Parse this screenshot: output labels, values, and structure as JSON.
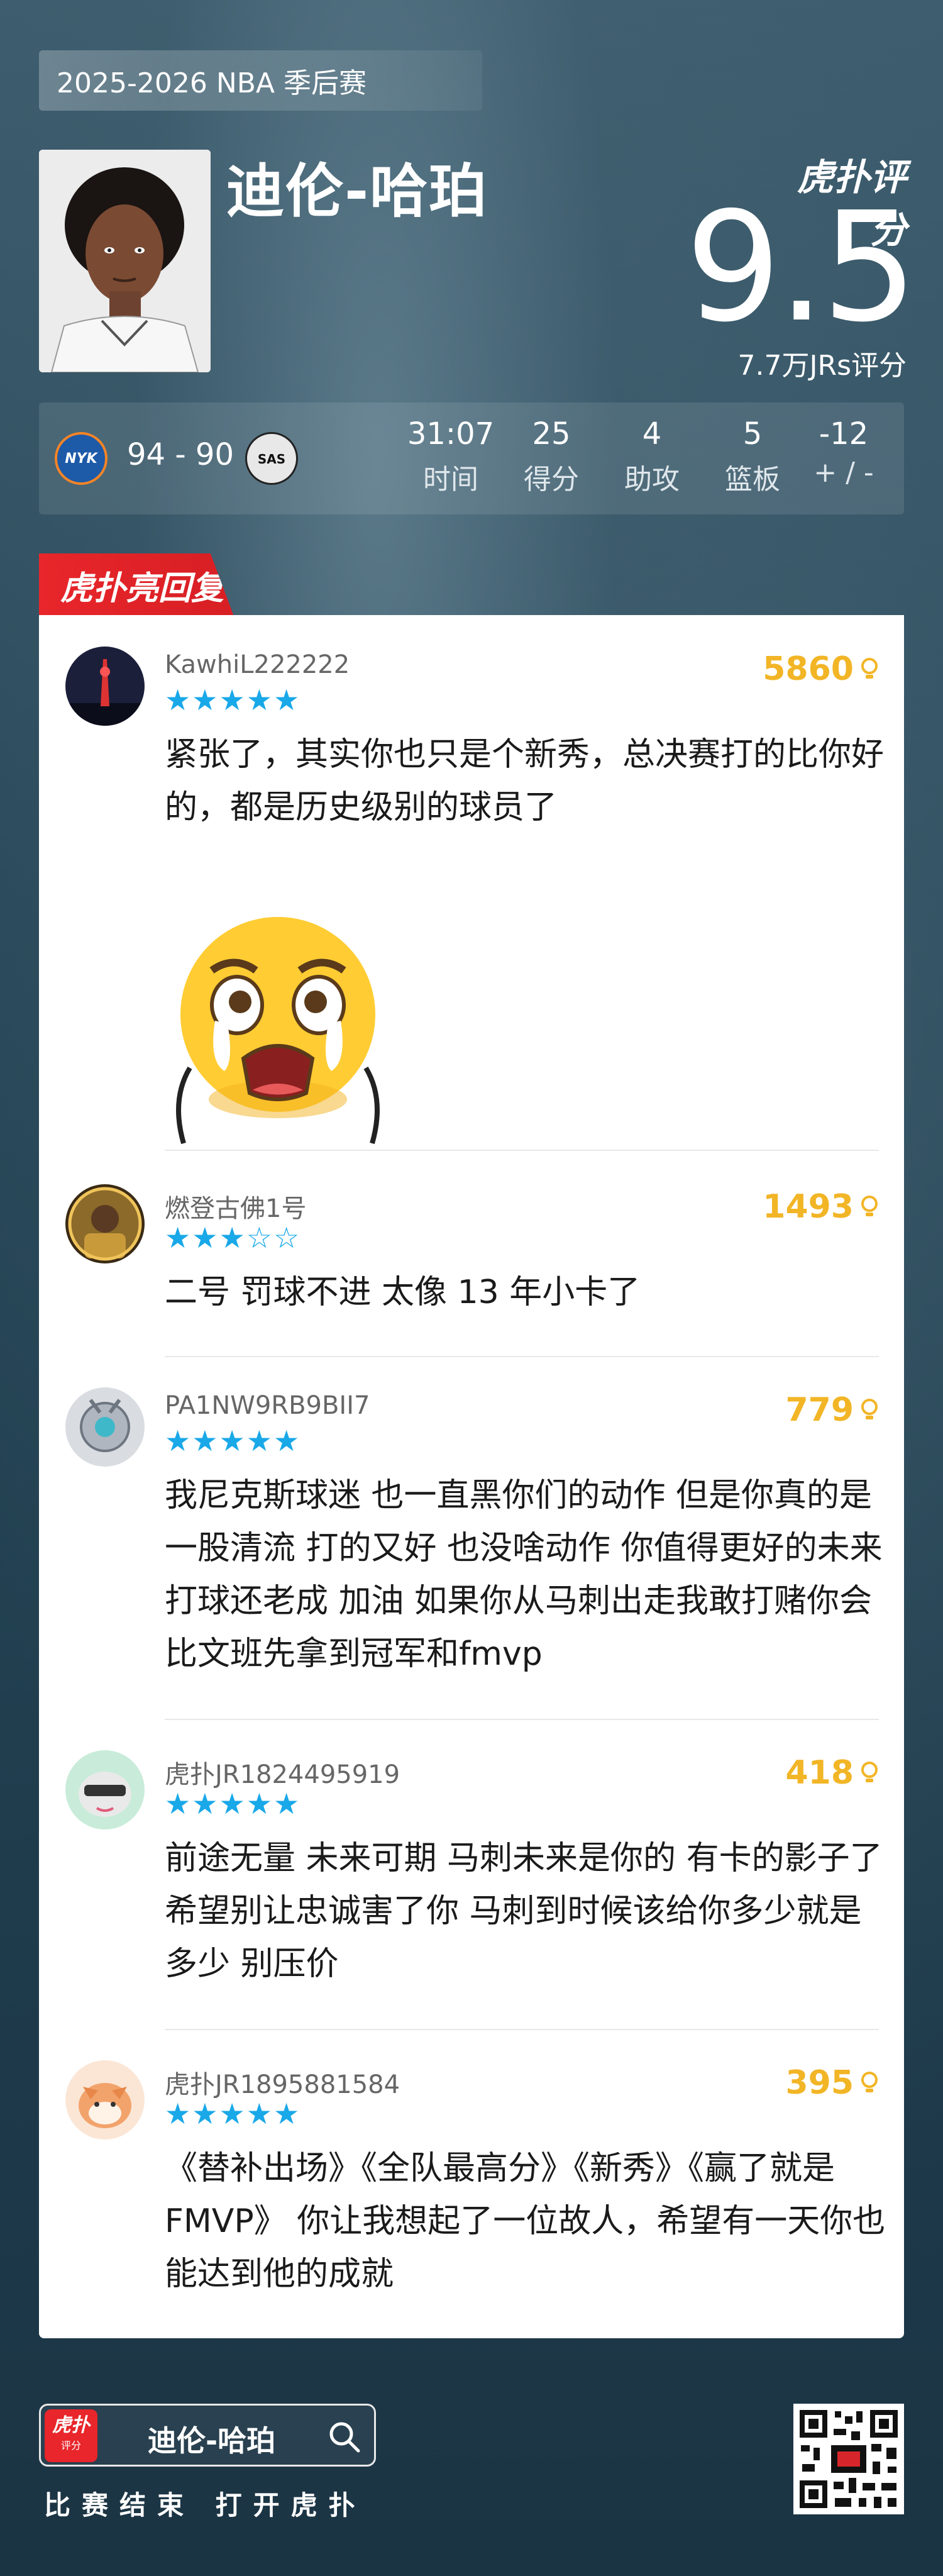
{
  "season": "2025-2026 NBA 季后赛",
  "player": {
    "name": "迪伦-哈珀",
    "rating": "9.5",
    "votes": "7.7万JRs评分",
    "brand": "虎扑评分"
  },
  "game": {
    "home_team": "NYK",
    "away_team": "SAS",
    "score": "94 - 90",
    "stats": [
      {
        "value": "31:07",
        "label": "时间"
      },
      {
        "value": "25",
        "label": "得分"
      },
      {
        "value": "4",
        "label": "助攻"
      },
      {
        "value": "5",
        "label": "篮板"
      },
      {
        "value": "-12",
        "label": "+ / -"
      }
    ]
  },
  "highlight_tag": "虎扑亮回复",
  "comments": [
    {
      "user": "KawhiL222222",
      "stars": 5,
      "likes": "5860",
      "text": "紧张了，其实你也只是个新秀，总决赛打的比你好的，都是历史级别的球员了"
    },
    {
      "user": "燃登古佛1号",
      "stars": 3,
      "likes": "1493",
      "text": "二号 罚球不进 太像 13 年小卡了"
    },
    {
      "user": "PA1NW9RB9BII7",
      "stars": 5,
      "likes": "779",
      "text": "我尼克斯球迷 也一直黑你们的动作 但是你真的是一股清流 打的又好 也没啥动作 你值得更好的未来 打球还老成 加油 如果你从马刺出走我敢打赌你会比文班先拿到冠军和fmvp"
    },
    {
      "user": "虎扑JR1824495919",
      "stars": 5,
      "likes": "418",
      "text": "前途无量 未来可期 马刺未来是你的 有卡的影子了 希望别让忠诚害了你 马刺到时候该给你多少就是多少 别压价"
    },
    {
      "user": "虎扑JR1895881584",
      "stars": 5,
      "likes": "395",
      "text": "《替补出场》《全队最高分》《新秀》《赢了就是FMVP》 你让我想起了一位故人，希望有一天你也能达到他的成就"
    }
  ],
  "footer": {
    "logo": "虎扑",
    "logo_sub": "评分",
    "search_name": "迪伦-哈珀",
    "subtitle": "比赛结束 打开虎扑"
  },
  "colors": {
    "accent_red": "#e8262b",
    "likes_gold": "#f2b526",
    "star_blue": "#19a8e8"
  }
}
